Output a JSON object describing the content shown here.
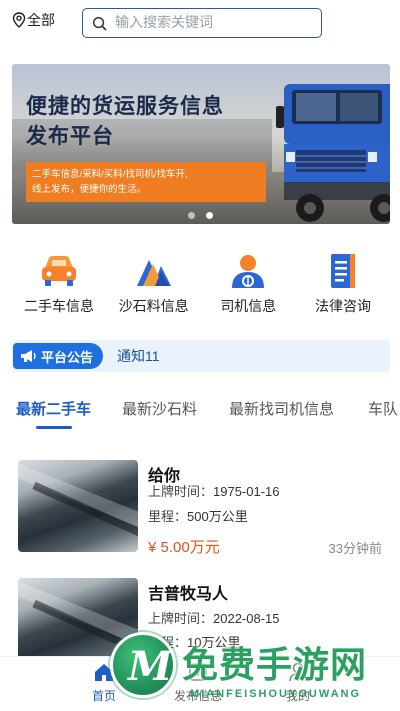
{
  "header": {
    "location_label": "全部",
    "search_placeholder": "输入搜索关键词"
  },
  "banner": {
    "title_line1": "便捷的货运服务信息",
    "title_line2": "发布平台",
    "subtitle_line1": "二手车信息/采料/买料/找司机/找车开,",
    "subtitle_line2": "线上发布，便捷你的生活。",
    "slide_count": 2,
    "active_slide": 2
  },
  "categories": [
    {
      "label": "二手车信息",
      "icon": "car-icon"
    },
    {
      "label": "沙石料信息",
      "icon": "sand-pile-icon"
    },
    {
      "label": "司机信息",
      "icon": "driver-icon"
    },
    {
      "label": "法律咨询",
      "icon": "law-book-icon"
    }
  ],
  "notice": {
    "tag": "平台公告",
    "text": "通知11"
  },
  "tabs": [
    {
      "label": "最新二手车",
      "active": true
    },
    {
      "label": "最新沙石料",
      "active": false
    },
    {
      "label": "最新找司机信息",
      "active": false
    },
    {
      "label": "车队",
      "active": false
    }
  ],
  "listings": [
    {
      "title": "给你",
      "reg_label": "上牌时间：",
      "reg_value": "1975-01-16",
      "mileage_label": "里程：",
      "mileage_value": "500万公里",
      "price": "¥ 5.00万元",
      "time_ago": "33分钟前"
    },
    {
      "title": "吉普牧马人",
      "reg_label": "上牌时间：",
      "reg_value": "2022-08-15",
      "mileage_label": "里程：",
      "mileage_value": "10万公里",
      "price": "",
      "time_ago": ""
    }
  ],
  "bottom_nav": [
    {
      "label": "首页",
      "icon": "home-icon",
      "active": true
    },
    {
      "label": "发布信息",
      "icon": "publish-icon",
      "active": false
    },
    {
      "label": "我的",
      "icon": "user-icon",
      "active": false
    }
  ],
  "watermark": {
    "logo_letter": "M",
    "text": "免费手游网",
    "sub": "MIANFEISHOUYOUWANG"
  },
  "colors": {
    "accent": "#1e5cc8",
    "price": "#e2521c",
    "banner_orange": "#f07d21",
    "notice_bg": "#eaf2fc"
  }
}
